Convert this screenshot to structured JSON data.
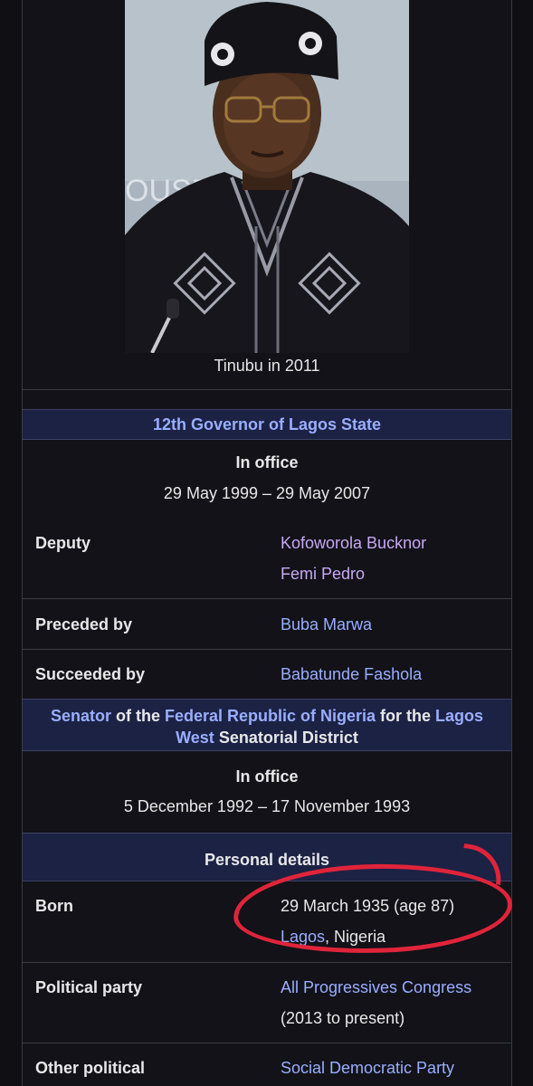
{
  "caption": "Tinubu in 2011",
  "governor": {
    "header_number": "12th",
    "header_title": "Governor of Lagos State",
    "in_office_label": "In office",
    "term": "29 May 1999 – 29 May 2007",
    "rows": [
      {
        "label": "Deputy",
        "values": [
          "Kofoworola Bucknor",
          "Femi Pedro"
        ]
      },
      {
        "label": "Preceded by",
        "values": [
          "Buba Marwa"
        ]
      },
      {
        "label": "Succeeded by",
        "values": [
          "Babatunde Fashola"
        ]
      }
    ]
  },
  "senator": {
    "w1": "Senator",
    "w2": " of the ",
    "w3": "Federal Republic of Nigeria",
    "w4": " for the ",
    "w5": "Lagos",
    "w6": "West",
    "w7": " Senatorial District",
    "in_office_label": "In office",
    "term": "5 December 1992 – 17 November 1993"
  },
  "personal": {
    "header": "Personal details",
    "born_label": "Born",
    "born_date": "29 March 1935 (age 87)",
    "born_city": "Lagos",
    "born_country": ", Nigeria",
    "party_label": "Political party",
    "party_name": "All Progressives Congress",
    "party_years": "(2013 to present)",
    "other_label": "Other political",
    "other_value": "Social Democratic Party"
  },
  "colors": {
    "link": "#9aaeff",
    "visited_link": "#c9a8f5",
    "header_bg": "#1c2244",
    "annotation": "#e0243a"
  }
}
